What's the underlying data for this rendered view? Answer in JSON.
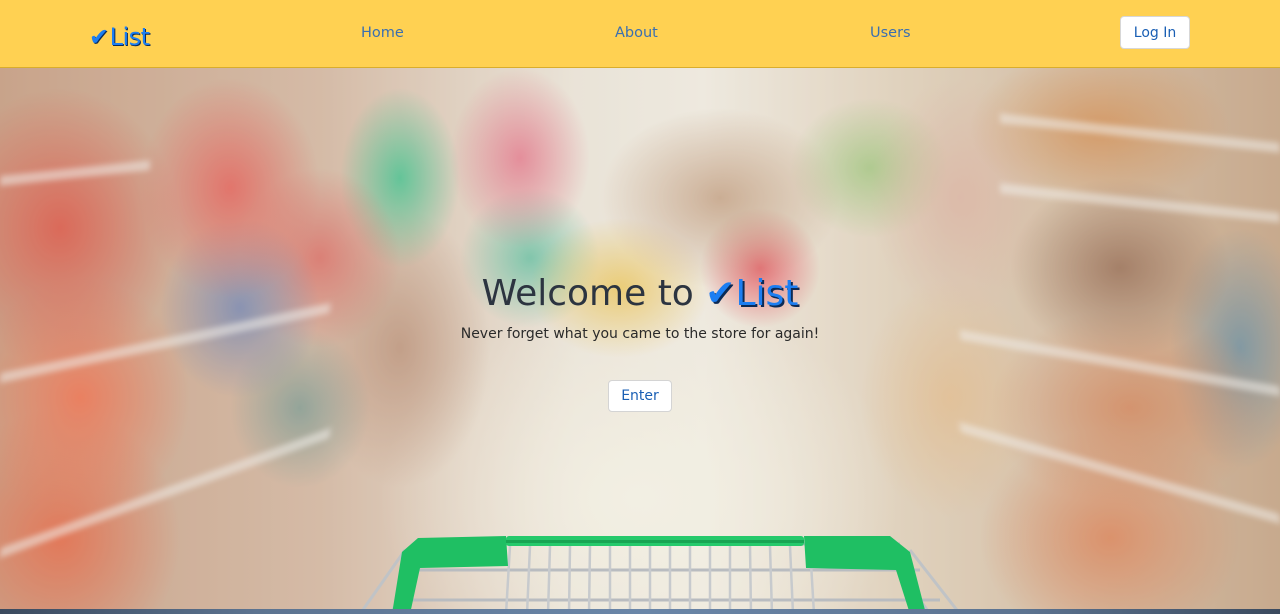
{
  "navbar": {
    "background_color": "#ffd152",
    "brand": {
      "check_glyph": "✔",
      "text": "List",
      "color": "#1c7ef2"
    },
    "links": {
      "home": "Home",
      "about": "About",
      "users": "Users"
    },
    "login_label": "Log In"
  },
  "hero": {
    "title_prefix": "Welcome to",
    "title_brand_check": "✔",
    "title_brand_text": "List",
    "subtitle": "Never forget what you came to the store for again!",
    "enter_label": "Enter",
    "background_description_icon": "shopping-cart-icon",
    "cart_color": "#1fbf63"
  }
}
